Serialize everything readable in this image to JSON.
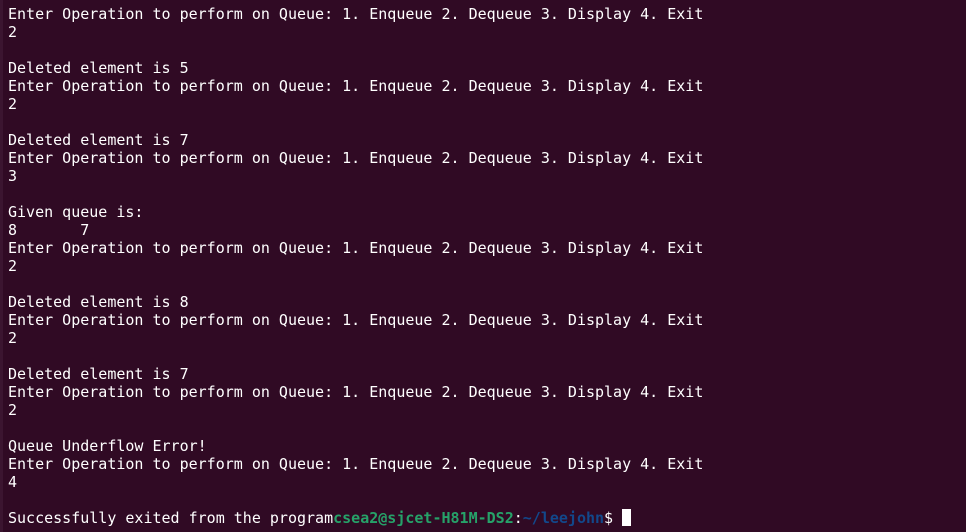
{
  "terminal": {
    "lines": [
      "Enter Operation to perform on Queue: 1. Enqueue 2. Dequeue 3. Display 4. Exit",
      "2",
      "",
      "Deleted element is 5",
      "Enter Operation to perform on Queue: 1. Enqueue 2. Dequeue 3. Display 4. Exit",
      "2",
      "",
      "Deleted element is 7",
      "Enter Operation to perform on Queue: 1. Enqueue 2. Dequeue 3. Display 4. Exit",
      "3",
      "",
      "Given queue is:",
      "8\t7",
      "Enter Operation to perform on Queue: 1. Enqueue 2. Dequeue 3. Display 4. Exit",
      "2",
      "",
      "Deleted element is 8",
      "Enter Operation to perform on Queue: 1. Enqueue 2. Dequeue 3. Display 4. Exit",
      "2",
      "",
      "Deleted element is 7",
      "Enter Operation to perform on Queue: 1. Enqueue 2. Dequeue 3. Display 4. Exit",
      "2",
      "",
      "Queue Underflow Error!",
      "Enter Operation to perform on Queue: 1. Enqueue 2. Dequeue 3. Display 4. Exit",
      "4",
      ""
    ],
    "final_line": {
      "output": "Successfully exited from the program",
      "prompt_user": "csea2@sjcet-H81M-DS2",
      "prompt_colon": ":",
      "prompt_path": "~/leejohn",
      "prompt_dollar": "$"
    },
    "colors": {
      "background": "#300a24",
      "text": "#ffffff",
      "prompt_user": "#26a269",
      "prompt_path": "#12488b"
    }
  }
}
